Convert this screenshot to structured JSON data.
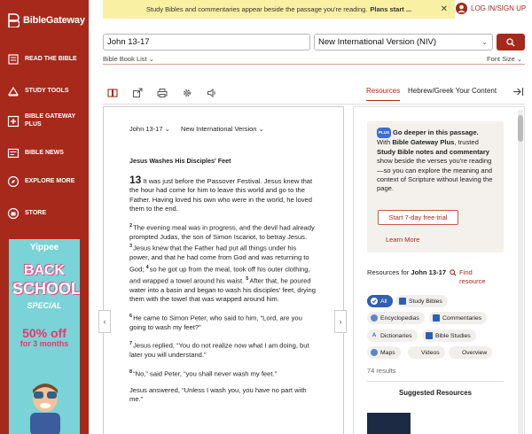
{
  "brand": {
    "name": "BibleGateway"
  },
  "sidebar": {
    "items": [
      {
        "label": "READ THE BIBLE",
        "icon": "book-icon"
      },
      {
        "label": "STUDY TOOLS",
        "icon": "study-tools-icon"
      },
      {
        "label": "BIBLE GATEWAY PLUS",
        "icon": "plus-icon"
      },
      {
        "label": "BIBLE NEWS",
        "icon": "news-icon"
      },
      {
        "label": "EXPLORE MORE",
        "icon": "compass-icon"
      },
      {
        "label": "STORE",
        "icon": "store-icon"
      }
    ]
  },
  "ad": {
    "brand": "Yippee",
    "line1": "BACK",
    "line2": "SCHOOL",
    "tagline": "SPECIAL",
    "offer_pct": "50% off",
    "offer_period": "for 3 months"
  },
  "banner": {
    "text": "Study Bibles and commentaries appear beside the passage you're reading.",
    "bold": "Plans start ..."
  },
  "login": {
    "label": "LOG IN/SIGN UP"
  },
  "search": {
    "value": "John 13-17",
    "version": "New International Version (NIV)"
  },
  "links": {
    "book_list": "Bible Book List",
    "font_size": "Font Size"
  },
  "tabs": {
    "resources": "Resources",
    "hebrew": "Hebrew/Greek Your Content"
  },
  "passage": {
    "ref": "John 13-17",
    "version": "New International Version",
    "heading": "Jesus Washes His Disciples' Feet",
    "chapter": "13",
    "v1": "It was just before the Passover Festival. Jesus knew that the hour had come for him to leave this world and go to the Father. Having loved his own who were in the world, he loved them to the end.",
    "v2": "The evening meal was in progress, and the devil had already prompted Judas, the son of Simon Iscariot, to betray Jesus.",
    "v3": "Jesus knew that the Father had put all things under his power, and that he had come from God and was returning to God;",
    "v4": "so he got up from the meal, took off his outer clothing, and wrapped a towel around his waist.",
    "v5": "After that, he poured water into a basin and began to wash his disciples' feet, drying them with the towel that was wrapped around him.",
    "v6": "He came to Simon Peter, who said to him, “Lord, are you going to wash my feet?”",
    "v7": "Jesus replied, “You do not realize now what I am doing, but later you will understand.”",
    "v8": "“No,” said Peter, “you shall never wash my feet.”",
    "v8b": "Jesus answered, “Unless I wash you, you have no part with me.”",
    "n2": "2",
    "n3": "3",
    "n4": "4",
    "n5": "5",
    "n6": "6",
    "n7": "7",
    "n8": "8"
  },
  "plus_promo": {
    "badge": "PLUS",
    "headline": "Go deeper in this passage.",
    "body_pre": "With",
    "body_bold1": "Bible Gateway Plus",
    "body_mid": ", trusted",
    "body_bold2": "Study Bible notes and commentary",
    "body_post": "show beside the verses you're reading—so you can explore the meaning and context of Scripture without leaving the page.",
    "cta": "Start 7-day free trial",
    "learn_more": "Learn More"
  },
  "resources": {
    "for_prefix": "Resources for",
    "for_ref": "John 13-17",
    "find": "Find resource",
    "chips": [
      "All",
      "Study Bibles",
      "Encyclopedias",
      "Commentaries",
      "Dictionaries",
      "Bible Studies",
      "Maps",
      "Videos",
      "Overview"
    ],
    "results": "74 results",
    "suggested": "Suggested Resources"
  },
  "colors": {
    "brand_red": "#a6291c",
    "chip_active": "#2f5fb5",
    "banner_yellow": "#faf0a4"
  }
}
